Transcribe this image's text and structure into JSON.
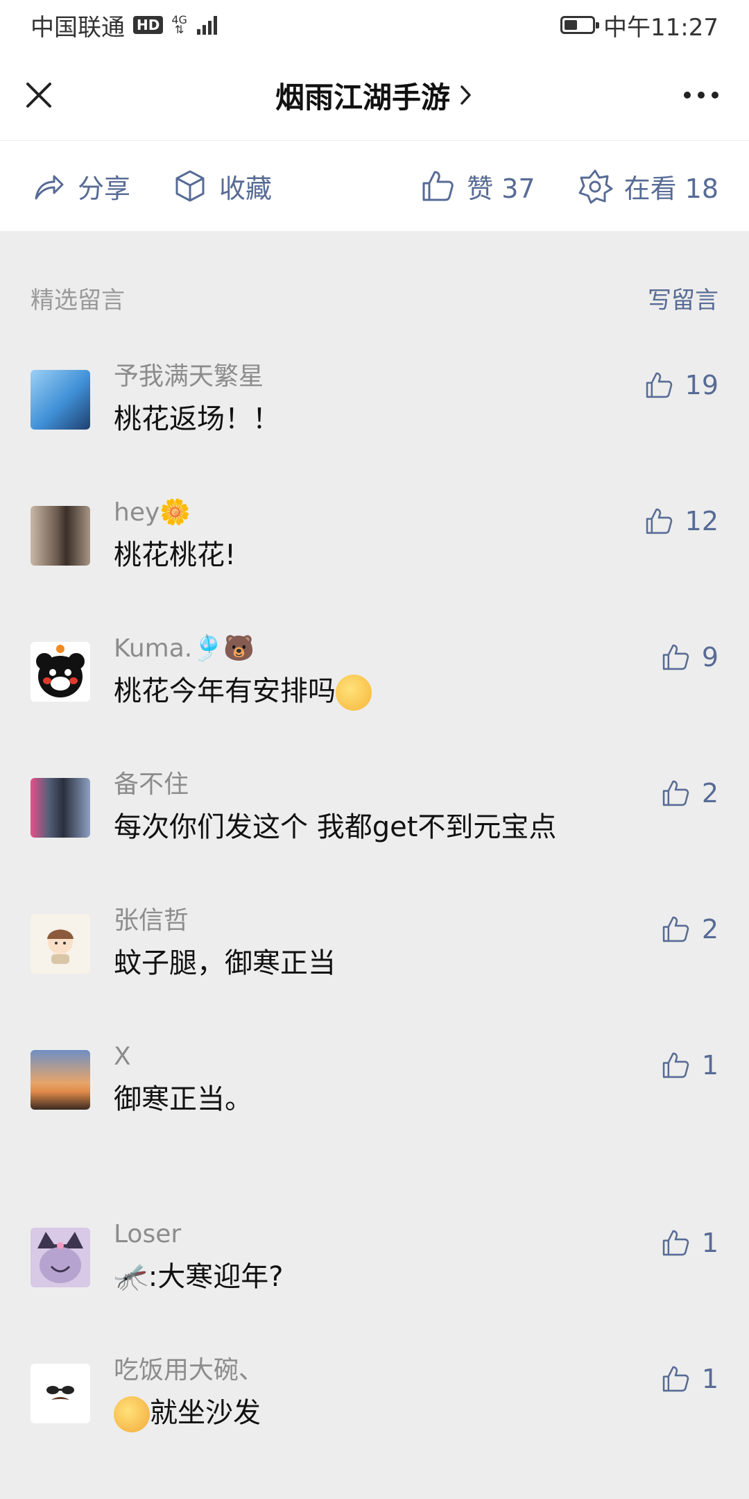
{
  "status": {
    "carrier": "中国联通",
    "hd": "HD",
    "network": "4G",
    "time": "中午11:27"
  },
  "nav": {
    "title": "烟雨江湖手游",
    "chevron": "›"
  },
  "actions": {
    "share": "分享",
    "favorite": "收藏",
    "like": "赞 37",
    "watching": "在看 18"
  },
  "section": {
    "label": "精选留言",
    "write": "写留言"
  },
  "comments": [
    {
      "name": "予我满天繁星",
      "text": "桃花返场！！",
      "likes": "19",
      "avatar_color": "#3f8fd6"
    },
    {
      "name": "hey🌼",
      "text": "桃花桃花!",
      "likes": "12",
      "avatar_color": "#6b5a4e"
    },
    {
      "name": "Kuma.🎐🐻",
      "text": "桃花今年有安排吗",
      "likes": "9",
      "avatar_color": "#ffffff"
    },
    {
      "name": "备不住",
      "text": "每次你们发这个  我都get不到元宝点",
      "likes": "2",
      "avatar_color": "#55607a"
    },
    {
      "name": "张信哲",
      "text": "蚊子腿，御寒正当",
      "likes": "2",
      "avatar_color": "#f5efe6"
    },
    {
      "name": "X",
      "text": "御寒正当。",
      "likes": "1",
      "avatar_color": "#e08a4a"
    },
    {
      "name": "Loser",
      "text": "🦟:大寒迎年?",
      "likes": "1",
      "avatar_color": "#b7a3cf"
    },
    {
      "name": "吃饭用大碗、",
      "text": "就坐沙发",
      "likes": "1",
      "avatar_color": "#ffffff"
    }
  ],
  "icons": {
    "close": "close-icon",
    "more": "more-icon",
    "share": "share-icon",
    "favorite": "box-icon",
    "like": "thumbs-up-icon",
    "watching": "star-icon"
  },
  "colors": {
    "accent": "#576b95",
    "background": "#ededed"
  }
}
